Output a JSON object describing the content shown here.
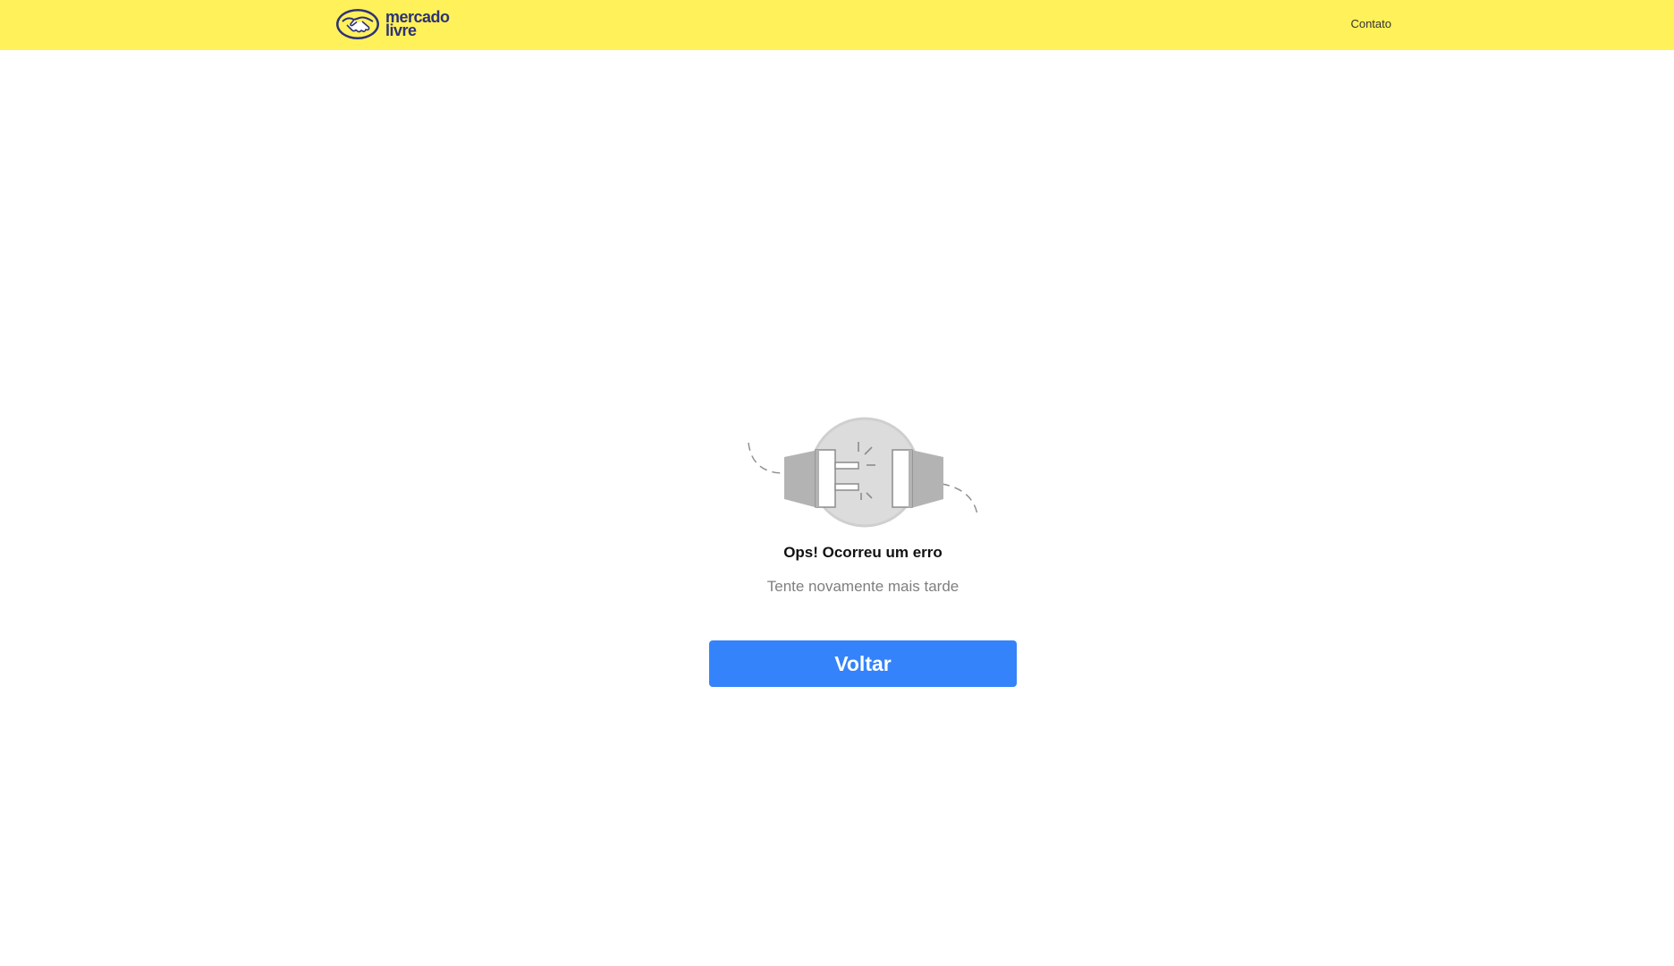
{
  "header": {
    "logo": {
      "line1": "mercado",
      "line2": "livre",
      "icon": "handshake-logo-icon"
    },
    "contact_label": "Contato",
    "background_color": "#fff159"
  },
  "error": {
    "illustration_icon": "disconnected-plug-icon",
    "title": "Ops! Ocorreu um erro",
    "subtitle": "Tente novamente mais tarde",
    "button_label": "Voltar",
    "button_color": "#3483fa"
  },
  "brand_color": "#2d3277"
}
